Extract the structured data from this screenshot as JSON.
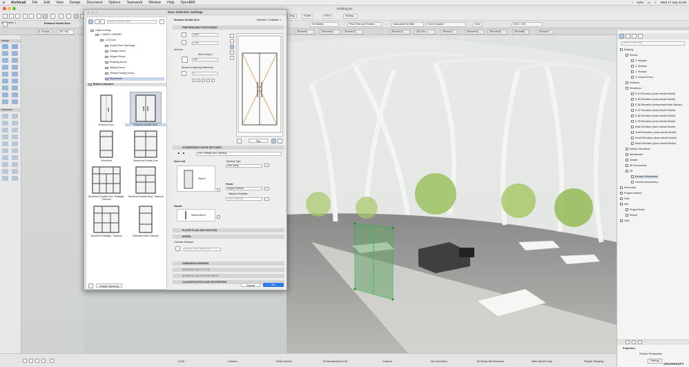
{
  "menubar": {
    "app": "Archicad",
    "items": [
      "File",
      "Edit",
      "View",
      "Design",
      "Document",
      "Options",
      "Teamwork",
      "Window",
      "Help",
      "OpenBIM"
    ],
    "battery": "63%",
    "datetime": "Wed 17 Sep 23:49"
  },
  "window": {
    "title": "building.pln"
  },
  "toolbar": {
    "element_name": "Entrance Double Door",
    "drag_label": "Drag",
    "rotate_label": "Rotate",
    "mirror_label": "Mirror",
    "multiply_label": "Multiply...",
    "marker_value": "No Marker",
    "floorplan_value": "Floor Plan and Section...",
    "associated_value": "Associated to Wall",
    "door_label": "Door",
    "id_value": "DOO - 003",
    "door_cropped": "Door Cropped"
  },
  "tabs": [
    {
      "label": "[0. Ground..."
    },
    {
      "label": "[3D / All]"
    },
    {
      "label": "[Picture4]"
    },
    {
      "label": "[Picture9]"
    },
    {
      "label": "[Picture10]"
    },
    {
      "label": "[Picture11]"
    },
    {
      "label": "[Picture12]"
    },
    {
      "label": "[3D (Ele...]"
    },
    {
      "label": "[Picture7]"
    },
    {
      "label": "[Picture13]"
    },
    {
      "label": "[Picture15]"
    },
    {
      "label": "[Picture8]"
    },
    {
      "label": "[Picture7]"
    }
  ],
  "toolbox": {
    "design_label": "Design",
    "document_label": "Document",
    "selection_label": "All Selection: 1"
  },
  "dialog": {
    "title": "Door Selection Settings",
    "search_placeholder": "Search Library Parts",
    "selected_info": "Selected: 1 Editable: 1",
    "part_name": "Entrance Double Door",
    "tree": {
      "object_library": "Object Library",
      "basic_library": "1. BASIC LIBRARY",
      "doors_folder": "1.2 Doors",
      "children": [
        "Empty Door Openings",
        "Garage Doors",
        "Hinged Doors",
        "Rotating Doors",
        "Sliding Doors",
        "Sliding Folding Doors",
        "Storefronts"
      ],
      "built_in": "Built-in Libraries"
    },
    "thumbs": [
      {
        "label": "Entrance Door"
      },
      {
        "label": "Entrance Double Door"
      },
      {
        "label": "Storefront"
      },
      {
        "label": "Storefront Double Door"
      },
      {
        "label": "Storefront Double Door, Sidelight, Transom"
      },
      {
        "label": "Storefront Double Door, Transom"
      },
      {
        "label": "Storefront Sidelight, Transom"
      },
      {
        "label": "Storefront with Transom"
      }
    ],
    "empty_opening_label": "Empty Opening",
    "preview": {
      "header": "PREVIEW AND POSITIONING",
      "width": "1500",
      "height": "2700",
      "anchors_label": "Anchors",
      "sill_label": "Sill to Story 0",
      "sill_value": "100",
      "reveal_label": "Reveal to Opening Reference",
      "reveal_value": "0",
      "flip_label": "Flip"
    },
    "storefront": {
      "header": "STOREFRONT DOOR SETTINGS",
      "sub_label": "Door Settings and Opening...",
      "door_leaf_label": "Door Leaf",
      "opening_type_label": "Opening Type",
      "opening_type_value": "Side Hung",
      "style_value": "Style 6",
      "frame_label": "Frame",
      "frame_value": "Simple Remote",
      "natural_vent_label": "Natural Ventilation",
      "clear_value": "Clear Opening",
      "handle_label": "Handle",
      "handle_value": "Vertical Bar 6"
    },
    "floorplan_header": "FLOOR PLAN AND SECTION",
    "model_header": "MODEL",
    "override_label": "Override Surfaces",
    "surface_value": "Wood - Pine Stained Ve...",
    "dimension_header": "DIMENSION MARKER",
    "marker_text_header": "MARKER TEXT STYLE",
    "marker_custom_header": "MARKER CUSTOM SETTINGS",
    "classification_header": "CLASSIFICATION AND PROPERTIES",
    "cancel_label": "Cancel",
    "ok_label": "OK"
  },
  "navigator": {
    "search_placeholder": "Search Project Map",
    "items": [
      {
        "label": "Building",
        "level": 0
      },
      {
        "label": "Stories",
        "level": 1
      },
      {
        "label": "3. Storeys",
        "level": 2
      },
      {
        "label": "2. Storeys",
        "level": 2
      },
      {
        "label": "1. Storeys",
        "level": 2
      },
      {
        "label": "0. Ground Floor",
        "level": 2
      },
      {
        "label": "Sections",
        "level": 1
      },
      {
        "label": "Elevations",
        "level": 1
      },
      {
        "label": "E-04 Elevation (Auto-rebuild Model)",
        "level": 2
      },
      {
        "label": "E-05 Elevation (Auto-rebuild Model)",
        "level": 2
      },
      {
        "label": "E-06 Elevation (Independent with Marker)",
        "level": 2
      },
      {
        "label": "E-07 Elevation (Auto-rebuild Model)",
        "level": 2
      },
      {
        "label": "E-08 Elevation (Auto-rebuild Model)",
        "level": 2
      },
      {
        "label": "E-09 Elevation (Auto-rebuild Model)",
        "level": 2
      },
      {
        "label": "East Elevation (Auto-rebuild Model)",
        "level": 2
      },
      {
        "label": "North Elevation (Auto-rebuild Model)",
        "level": 2
      },
      {
        "label": "South Elevation (Auto-rebuild Model)",
        "level": 2
      },
      {
        "label": "West Elevation (Auto-rebuild Model)",
        "level": 2
      },
      {
        "label": "Interior Elevations",
        "level": 1
      },
      {
        "label": "Worksheets",
        "level": 1
      },
      {
        "label": "Details",
        "level": 1
      },
      {
        "label": "3D Documents",
        "level": 1
      },
      {
        "label": "3D",
        "level": 1
      },
      {
        "label": "Generic Perspective",
        "level": 2
      },
      {
        "label": "Generic Axonometry",
        "level": 2
      },
      {
        "label": "Schedules",
        "level": 0
      },
      {
        "label": "Project Indexes",
        "level": 0
      },
      {
        "label": "Lists",
        "level": 0
      },
      {
        "label": "Info",
        "level": 0
      },
      {
        "label": "Project Notes",
        "level": 1
      },
      {
        "label": "Report",
        "level": 1
      },
      {
        "label": "Help",
        "level": 0
      }
    ],
    "properties_label": "Properties",
    "properties_value": "Generic Perspective",
    "settings_label": "Settings"
  },
  "status": {
    "scale": "1:100",
    "custom1": "Custom",
    "entire_model": "Entire Model",
    "arch": "03 Architectural 100",
    "custom2": "Custom",
    "overrides": "No Overrides",
    "elements": "00 Show All Elements",
    "model_only": "Main Model Only",
    "shading": "Simple Shading",
    "logo": "GRAPHISOFT"
  }
}
